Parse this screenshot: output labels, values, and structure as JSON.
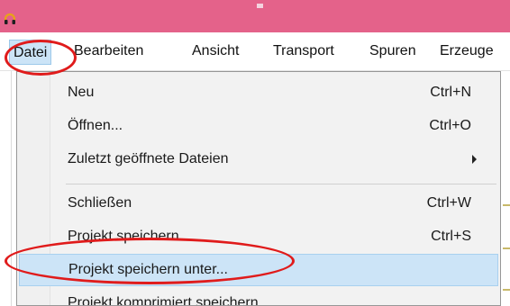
{
  "window": {
    "app_icon": "headphones-icon"
  },
  "menubar": {
    "items": [
      "Datei",
      "Bearbeiten",
      "Ansicht",
      "Transport",
      "Spuren",
      "Erzeuge"
    ]
  },
  "file_menu": {
    "items": [
      {
        "label": "Neu",
        "shortcut": "Ctrl+N"
      },
      {
        "label": "Öffnen...",
        "shortcut": "Ctrl+O"
      },
      {
        "label": "Zuletzt geöffnete Dateien",
        "submenu": true
      },
      {
        "label": "Schließen",
        "shortcut": "Ctrl+W"
      },
      {
        "label": "Projekt speichern",
        "shortcut": "Ctrl+S"
      },
      {
        "label": "Projekt speichern unter..."
      },
      {
        "label": "Projekt komprimiert speichern"
      }
    ]
  },
  "annotations": {
    "color": "#e01b1b",
    "highlighted": [
      "Datei",
      "Projekt speichern unter..."
    ]
  }
}
